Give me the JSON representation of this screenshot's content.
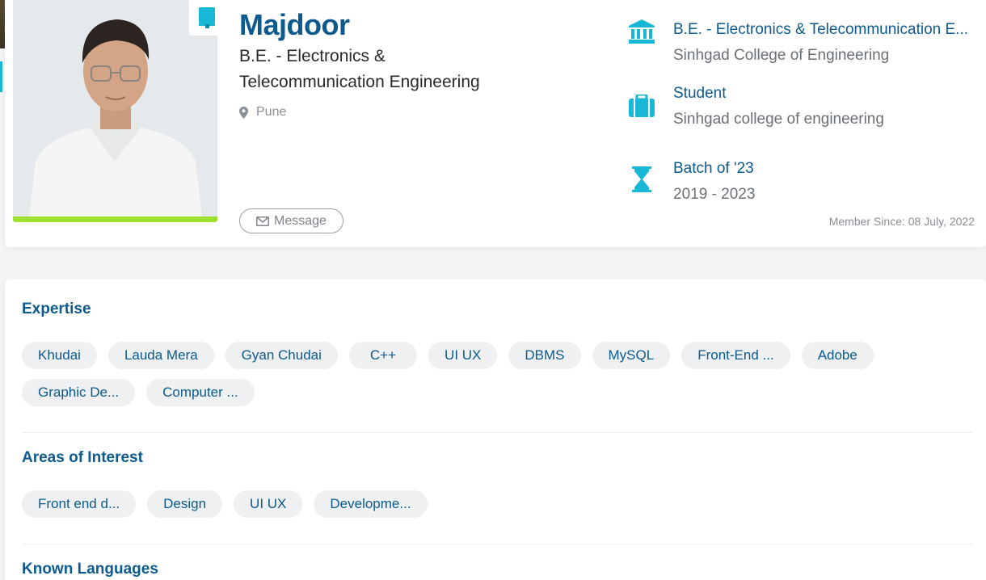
{
  "profile": {
    "name": "Majdoor",
    "degree": "B.E. - Electronics & Telecommunication Engineering",
    "location": "Pune",
    "message_label": "Message",
    "member_since": "Member Since: 08 July, 2022"
  },
  "info": {
    "education_title": "B.E. - Electronics & Telecommunication E...",
    "education_sub": "Sinhgad College of Engineering",
    "role_title": "Student",
    "role_sub": "Sinhgad college of engineering",
    "batch_title": "Batch of '23",
    "batch_sub": "2019 - 2023"
  },
  "sections": {
    "expertise_title": "Expertise",
    "expertise": [
      "Khudai",
      "Lauda Mera",
      "Gyan Chudai",
      "C++",
      "UI UX",
      "DBMS",
      "MySQL",
      "Front-End ...",
      "Adobe",
      "Graphic De...",
      "Computer ..."
    ],
    "interest_title": "Areas of Interest",
    "interests": [
      "Front end d...",
      "Design",
      "UI UX",
      "Developme..."
    ],
    "languages_title": "Known Languages"
  },
  "colors": {
    "brand_blue": "#0c5a8e",
    "accent_cyan": "#18b7d6",
    "photo_bar_green": "#9de02e"
  },
  "icons": [
    "bookmark-icon",
    "map-pin-icon",
    "mail-icon",
    "institution-icon",
    "briefcase-icon",
    "hourglass-icon"
  ]
}
